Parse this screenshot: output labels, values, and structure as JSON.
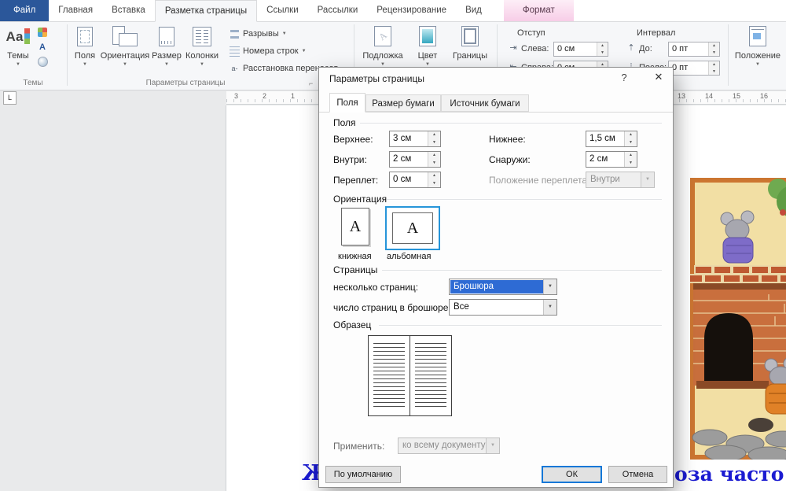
{
  "ribbon_tabs": [
    {
      "label": "Файл"
    },
    {
      "label": "Главная"
    },
    {
      "label": "Вставка"
    },
    {
      "label": "Разметка страницы"
    },
    {
      "label": "Ссылки"
    },
    {
      "label": "Рассылки"
    },
    {
      "label": "Рецензирование"
    },
    {
      "label": "Вид"
    },
    {
      "label": "Формат"
    }
  ],
  "themes_group": {
    "button_label": "Темы",
    "group_label": "Темы"
  },
  "page_setup_group": {
    "group_label": "Параметры страницы",
    "margins_button": "Поля",
    "orientation_button": "Ориентация",
    "size_button": "Размер",
    "columns_button": "Колонки",
    "breaks_button": "Разрывы",
    "line_numbers_button": "Номера строк",
    "hyphenation_button": "Расстановка переносов"
  },
  "background_group": {
    "watermark_button": "Подложка",
    "page_color_button": "Цвет",
    "page_borders_button": "Границы"
  },
  "paragraph_group": {
    "indent_label": "Отступ",
    "spacing_label": "Интервал",
    "left_label": "Слева:",
    "left_value": "0 см",
    "right_label": "Справа:",
    "right_value": "0 см",
    "before_label": "До:",
    "before_value": "0 пт",
    "after_label": "После:",
    "after_value": "0 пт"
  },
  "arrange_group": {
    "position_button": "Положение"
  },
  "ruler": {
    "tab_selector": "L",
    "left_numbers": [
      "3",
      "2",
      "1"
    ],
    "right_numbers": [
      "13",
      "14",
      "15",
      "16"
    ]
  },
  "icons": {
    "dropdown_arrow": "▼",
    "spin_up": "▲",
    "spin_down": "▼",
    "watermark_glyph": "А",
    "fonts_glyph": "А",
    "hyphen_glyph": "a-",
    "indent_left_glyph": "⇥",
    "indent_right_glyph": "⇤",
    "space_before_glyph": "⇡",
    "space_after_glyph": "⇣",
    "launcher_glyph": "⌐"
  },
  "dialog": {
    "title": "Параметры страницы",
    "help_button": "?",
    "close_button": "✕",
    "tabs": [
      {
        "label": "Поля"
      },
      {
        "label": "Размер бумаги"
      },
      {
        "label": "Источник бумаги"
      }
    ],
    "margins": {
      "caption": "Поля",
      "top_label": "Верхнее:",
      "top_value": "3 см",
      "bottom_label": "Нижнее:",
      "bottom_value": "1,5 см",
      "inside_label": "Внутри:",
      "inside_value": "2 см",
      "outside_label": "Снаружи:",
      "outside_value": "2 см",
      "gutter_label": "Переплет:",
      "gutter_value": "0 см",
      "gutter_pos_label": "Положение переплета:",
      "gutter_pos_value": "Внутри"
    },
    "orientation": {
      "caption": "Ориентация",
      "portrait_label": "книжная",
      "landscape_label": "альбомная",
      "page_glyph": "A"
    },
    "pages": {
      "caption": "Страницы",
      "multiple_label": "несколько страниц:",
      "multiple_value": "Брошюра",
      "per_booklet_label": "число страниц в брошюре:",
      "per_booklet_value": "Все"
    },
    "preview": {
      "caption": "Образец",
      "apply_label": "Применить:",
      "apply_value": "ко всему документу"
    },
    "default_button": "По умолчанию",
    "ok_button": "ОК",
    "cancel_button": "Отмена"
  },
  "document_text": {
    "left_fragment": "Ж",
    "right_fragment": "оза часто"
  }
}
